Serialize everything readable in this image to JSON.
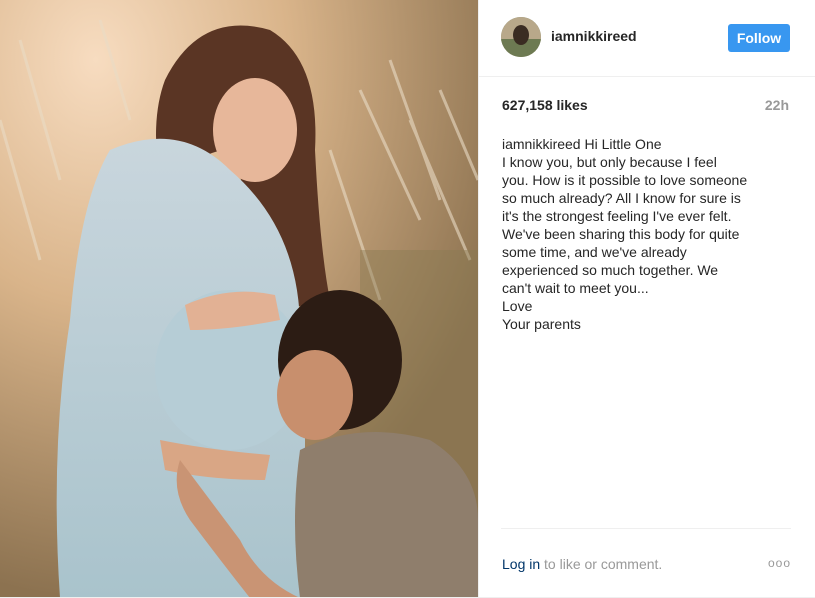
{
  "post": {
    "username": "iamnikkireed",
    "follow_label": "Follow",
    "likes": "627,158 likes",
    "time_ago": "22h",
    "caption_user": "iamnikkireed",
    "caption_lines": [
      "Hi Little One",
      "I know you, but only because I feel",
      "you. How is it possible to love someone",
      "so much already? All I know for sure is",
      "it's the strongest feeling I've ever felt.",
      "We've been sharing this body for quite",
      "some time, and we've already",
      "experienced so much together. We",
      "can't wait to meet you...",
      "Love",
      "Your parents"
    ],
    "login_label": "Log in",
    "login_suffix": " to like or comment.",
    "more_glyph": "ooo"
  },
  "colors": {
    "accent": "#3897f0",
    "link": "#003569",
    "muted": "#999999",
    "text": "#262626"
  },
  "icons": {
    "more": "more-options-icon"
  }
}
